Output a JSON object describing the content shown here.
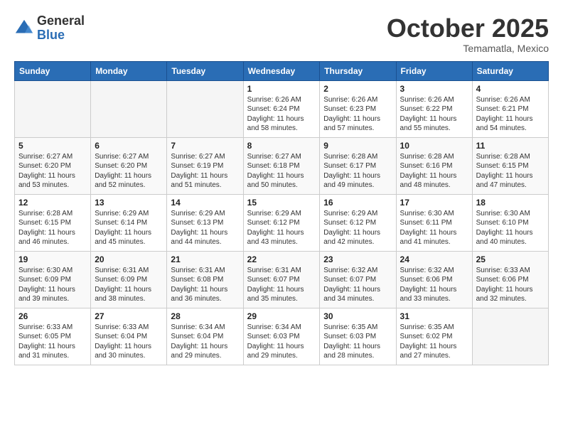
{
  "header": {
    "logo_general": "General",
    "logo_blue": "Blue",
    "month": "October 2025",
    "location": "Temamatla, Mexico"
  },
  "weekdays": [
    "Sunday",
    "Monday",
    "Tuesday",
    "Wednesday",
    "Thursday",
    "Friday",
    "Saturday"
  ],
  "weeks": [
    [
      {
        "day": "",
        "info": ""
      },
      {
        "day": "",
        "info": ""
      },
      {
        "day": "",
        "info": ""
      },
      {
        "day": "1",
        "info": "Sunrise: 6:26 AM\nSunset: 6:24 PM\nDaylight: 11 hours\nand 58 minutes."
      },
      {
        "day": "2",
        "info": "Sunrise: 6:26 AM\nSunset: 6:23 PM\nDaylight: 11 hours\nand 57 minutes."
      },
      {
        "day": "3",
        "info": "Sunrise: 6:26 AM\nSunset: 6:22 PM\nDaylight: 11 hours\nand 55 minutes."
      },
      {
        "day": "4",
        "info": "Sunrise: 6:26 AM\nSunset: 6:21 PM\nDaylight: 11 hours\nand 54 minutes."
      }
    ],
    [
      {
        "day": "5",
        "info": "Sunrise: 6:27 AM\nSunset: 6:20 PM\nDaylight: 11 hours\nand 53 minutes."
      },
      {
        "day": "6",
        "info": "Sunrise: 6:27 AM\nSunset: 6:20 PM\nDaylight: 11 hours\nand 52 minutes."
      },
      {
        "day": "7",
        "info": "Sunrise: 6:27 AM\nSunset: 6:19 PM\nDaylight: 11 hours\nand 51 minutes."
      },
      {
        "day": "8",
        "info": "Sunrise: 6:27 AM\nSunset: 6:18 PM\nDaylight: 11 hours\nand 50 minutes."
      },
      {
        "day": "9",
        "info": "Sunrise: 6:28 AM\nSunset: 6:17 PM\nDaylight: 11 hours\nand 49 minutes."
      },
      {
        "day": "10",
        "info": "Sunrise: 6:28 AM\nSunset: 6:16 PM\nDaylight: 11 hours\nand 48 minutes."
      },
      {
        "day": "11",
        "info": "Sunrise: 6:28 AM\nSunset: 6:15 PM\nDaylight: 11 hours\nand 47 minutes."
      }
    ],
    [
      {
        "day": "12",
        "info": "Sunrise: 6:28 AM\nSunset: 6:15 PM\nDaylight: 11 hours\nand 46 minutes."
      },
      {
        "day": "13",
        "info": "Sunrise: 6:29 AM\nSunset: 6:14 PM\nDaylight: 11 hours\nand 45 minutes."
      },
      {
        "day": "14",
        "info": "Sunrise: 6:29 AM\nSunset: 6:13 PM\nDaylight: 11 hours\nand 44 minutes."
      },
      {
        "day": "15",
        "info": "Sunrise: 6:29 AM\nSunset: 6:12 PM\nDaylight: 11 hours\nand 43 minutes."
      },
      {
        "day": "16",
        "info": "Sunrise: 6:29 AM\nSunset: 6:12 PM\nDaylight: 11 hours\nand 42 minutes."
      },
      {
        "day": "17",
        "info": "Sunrise: 6:30 AM\nSunset: 6:11 PM\nDaylight: 11 hours\nand 41 minutes."
      },
      {
        "day": "18",
        "info": "Sunrise: 6:30 AM\nSunset: 6:10 PM\nDaylight: 11 hours\nand 40 minutes."
      }
    ],
    [
      {
        "day": "19",
        "info": "Sunrise: 6:30 AM\nSunset: 6:09 PM\nDaylight: 11 hours\nand 39 minutes."
      },
      {
        "day": "20",
        "info": "Sunrise: 6:31 AM\nSunset: 6:09 PM\nDaylight: 11 hours\nand 38 minutes."
      },
      {
        "day": "21",
        "info": "Sunrise: 6:31 AM\nSunset: 6:08 PM\nDaylight: 11 hours\nand 36 minutes."
      },
      {
        "day": "22",
        "info": "Sunrise: 6:31 AM\nSunset: 6:07 PM\nDaylight: 11 hours\nand 35 minutes."
      },
      {
        "day": "23",
        "info": "Sunrise: 6:32 AM\nSunset: 6:07 PM\nDaylight: 11 hours\nand 34 minutes."
      },
      {
        "day": "24",
        "info": "Sunrise: 6:32 AM\nSunset: 6:06 PM\nDaylight: 11 hours\nand 33 minutes."
      },
      {
        "day": "25",
        "info": "Sunrise: 6:33 AM\nSunset: 6:06 PM\nDaylight: 11 hours\nand 32 minutes."
      }
    ],
    [
      {
        "day": "26",
        "info": "Sunrise: 6:33 AM\nSunset: 6:05 PM\nDaylight: 11 hours\nand 31 minutes."
      },
      {
        "day": "27",
        "info": "Sunrise: 6:33 AM\nSunset: 6:04 PM\nDaylight: 11 hours\nand 30 minutes."
      },
      {
        "day": "28",
        "info": "Sunrise: 6:34 AM\nSunset: 6:04 PM\nDaylight: 11 hours\nand 29 minutes."
      },
      {
        "day": "29",
        "info": "Sunrise: 6:34 AM\nSunset: 6:03 PM\nDaylight: 11 hours\nand 29 minutes."
      },
      {
        "day": "30",
        "info": "Sunrise: 6:35 AM\nSunset: 6:03 PM\nDaylight: 11 hours\nand 28 minutes."
      },
      {
        "day": "31",
        "info": "Sunrise: 6:35 AM\nSunset: 6:02 PM\nDaylight: 11 hours\nand 27 minutes."
      },
      {
        "day": "",
        "info": ""
      }
    ]
  ]
}
